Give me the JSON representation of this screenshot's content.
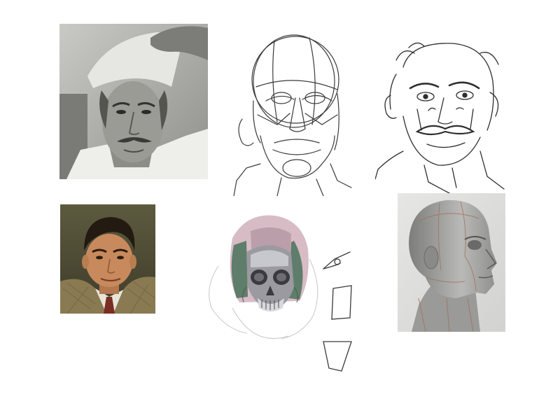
{
  "figures": [
    {
      "name": "photo-elderly-man",
      "kind": "photograph",
      "tone": "grayscale"
    },
    {
      "name": "sketch-head-construction",
      "kind": "pencil-sketch"
    },
    {
      "name": "sketch-head-finished",
      "kind": "pencil-sketch"
    },
    {
      "name": "photo-actor-portrait",
      "kind": "photograph",
      "tone": "color"
    },
    {
      "name": "skull-study-sketch",
      "kind": "digital-painting"
    },
    {
      "name": "shape-studies",
      "kind": "pencil-sketch",
      "shapes": [
        "eye-wedge",
        "rectangle",
        "trapezoid"
      ]
    },
    {
      "name": "ecorche-head-model",
      "kind": "3d-render"
    }
  ],
  "colors": {
    "background": "#ffffff",
    "pencil": "#3a3a3a",
    "photo_gray": "#8a8a86",
    "skull_green": "#5f7d6b",
    "skull_mauve": "#b79aa6",
    "ecorche_gray": "#9e9e9c"
  }
}
